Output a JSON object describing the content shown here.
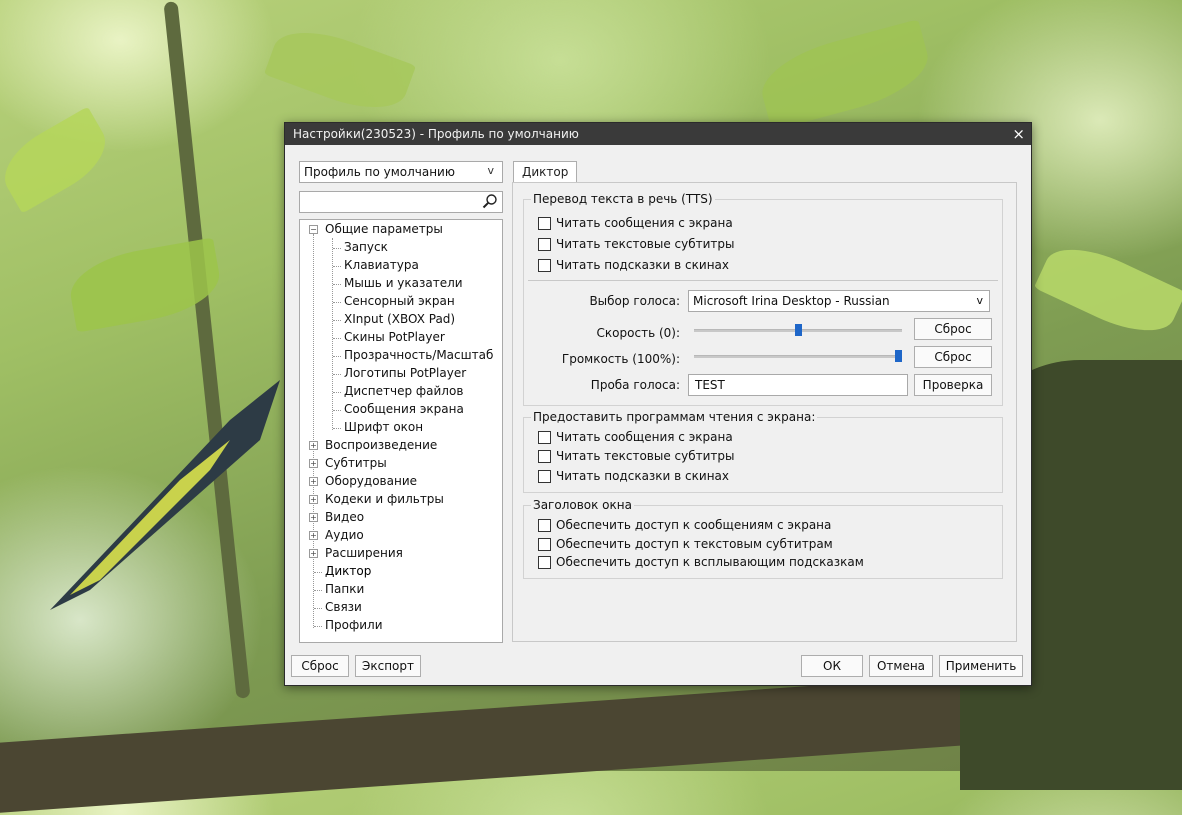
{
  "window": {
    "title": "Настройки(230523) - Профиль по умолчанию",
    "close_glyph": "×"
  },
  "left_panel": {
    "profile_select": {
      "value": "Профиль по умолчанию",
      "chevron": "v"
    },
    "search": {
      "value": "",
      "icon": "search-icon"
    },
    "tree": {
      "general": {
        "label": "Общие параметры",
        "expander": "−",
        "children": [
          "Запуск",
          "Клавиатура",
          "Мышь и указатели",
          "Сенсорный экран",
          "XInput (XBOX Pad)",
          "Скины PotPlayer",
          "Прозрачность/Масштаб",
          "Логотипы PotPlayer",
          "Диспетчер файлов",
          "Сообщения экрана",
          "Шрифт окон"
        ]
      },
      "collapsed": [
        {
          "label": "Воспроизведение",
          "expander": "+"
        },
        {
          "label": "Субтитры",
          "expander": "+"
        },
        {
          "label": "Оборудование",
          "expander": "+"
        },
        {
          "label": "Кодеки и фильтры",
          "expander": "+"
        },
        {
          "label": "Видео",
          "expander": "+"
        },
        {
          "label": "Аудио",
          "expander": "+"
        },
        {
          "label": "Расширения",
          "expander": "+"
        }
      ],
      "leaves": [
        "Диктор",
        "Папки",
        "Связи",
        "Профили"
      ],
      "selected": "Диктор"
    }
  },
  "tabs": [
    {
      "label": "Диктор",
      "active": true
    }
  ],
  "tts_group": {
    "title": "Перевод текста в речь (TTS)",
    "checks": [
      {
        "label": "Читать сообщения с экрана",
        "checked": false
      },
      {
        "label": "Читать текстовые субтитры",
        "checked": false
      },
      {
        "label": "Читать подсказки в скинах",
        "checked": false
      }
    ],
    "voice_label": "Выбор голоса:",
    "voice_value": "Microsoft Irina Desktop - Russian",
    "voice_chevron": "v",
    "speed_label": "Скорость (0):",
    "speed_level": 0.5,
    "volume_label": "Громкость (100%):",
    "volume_level": 1.0,
    "reset_label": "Сброс",
    "test_label": "Проба голоса:",
    "test_value": "TEST",
    "check_button": "Проверка"
  },
  "screenreader_group": {
    "title": "Предоставить программам чтения с экрана:",
    "checks": [
      {
        "label": "Читать сообщения с экрана",
        "checked": false
      },
      {
        "label": "Читать текстовые субтитры",
        "checked": false
      },
      {
        "label": "Читать подсказки в скинах",
        "checked": false
      }
    ]
  },
  "title_group": {
    "title": "Заголовок окна",
    "checks": [
      {
        "label": "Обеспечить доступ к сообщениям с экрана",
        "checked": false
      },
      {
        "label": "Обеспечить доступ к текстовым субтитрам",
        "checked": false
      },
      {
        "label": "Обеспечить доступ к всплывающим подсказкам",
        "checked": false
      }
    ]
  },
  "footer": {
    "reset": "Сброс",
    "export": "Экспорт",
    "ok": "ОК",
    "cancel": "Отмена",
    "apply": "Применить"
  },
  "colors": {
    "accent": "#1e66c8",
    "titlebar": "#3a3a3a"
  }
}
